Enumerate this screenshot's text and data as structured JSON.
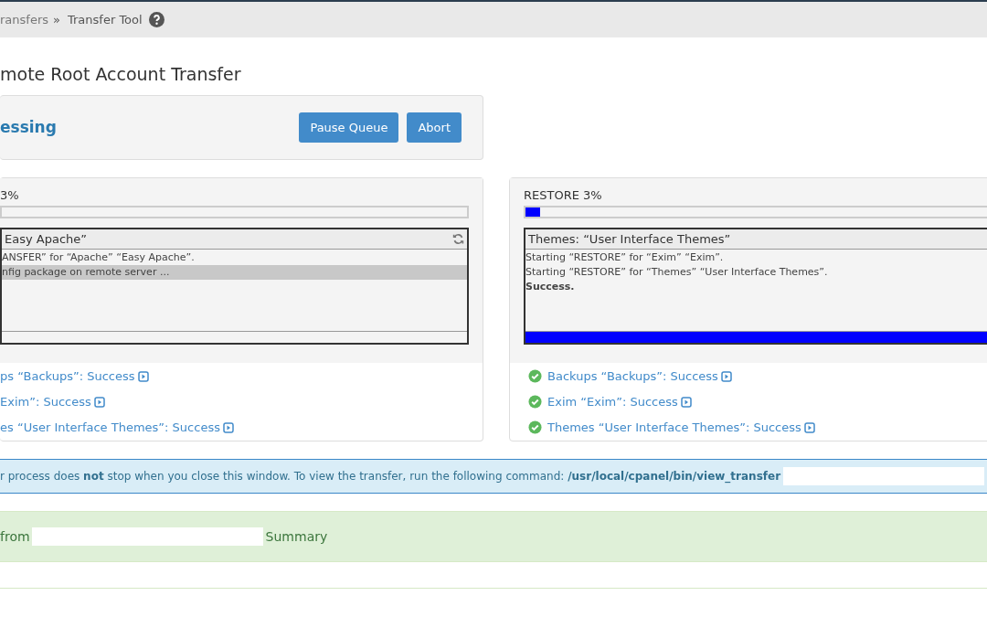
{
  "breadcrumb": {
    "parent": "ransfers",
    "separator": "»",
    "current": "Transfer Tool"
  },
  "title": "mote Root Account Transfer",
  "queue": {
    "status": "essing",
    "buttons": [
      "Pause Queue",
      "Abort"
    ]
  },
  "panels": [
    {
      "label": "3%",
      "header": "Easy Apache”",
      "refresh_icon": true,
      "bar_filled": false,
      "log": [
        {
          "text": "ANSFER” for “Apache” “Easy Apache”.",
          "selected": false,
          "bold": false
        },
        {
          "text": "nfig package on remote server ...",
          "selected": true,
          "bold": false
        }
      ],
      "results": [
        {
          "text": "ps “Backups”: Success",
          "status_icon": false
        },
        {
          "text": "Exim”: Success",
          "status_icon": false
        },
        {
          "text": "es “User Interface Themes”: Success",
          "status_icon": false
        }
      ]
    },
    {
      "label": "RESTORE 3%",
      "level": 0.03,
      "header": "Themes: “User Interface Themes”",
      "refresh_icon": false,
      "bar_filled": true,
      "log": [
        {
          "text": "Starting “RESTORE” for “Exim” “Exim”.",
          "selected": false,
          "bold": false
        },
        {
          "text": "Starting “RESTORE” for “Themes” “User Interface Themes”.",
          "selected": false,
          "bold": false
        },
        {
          "text": "Success.",
          "selected": false,
          "bold": true
        }
      ],
      "results": [
        {
          "text": "Backups “Backups”: Success",
          "status_icon": true
        },
        {
          "text": "Exim “Exim”: Success",
          "status_icon": true
        },
        {
          "text": "Themes “User Interface Themes”: Success",
          "status_icon": true
        }
      ]
    }
  ],
  "notice": "r process does **not** stop when you close this window. To view the transfer, run the following command: **/usr/local/cpanel/bin/view_transfer**",
  "summary": {
    "prefix": "from",
    "suffix": "Summary"
  }
}
